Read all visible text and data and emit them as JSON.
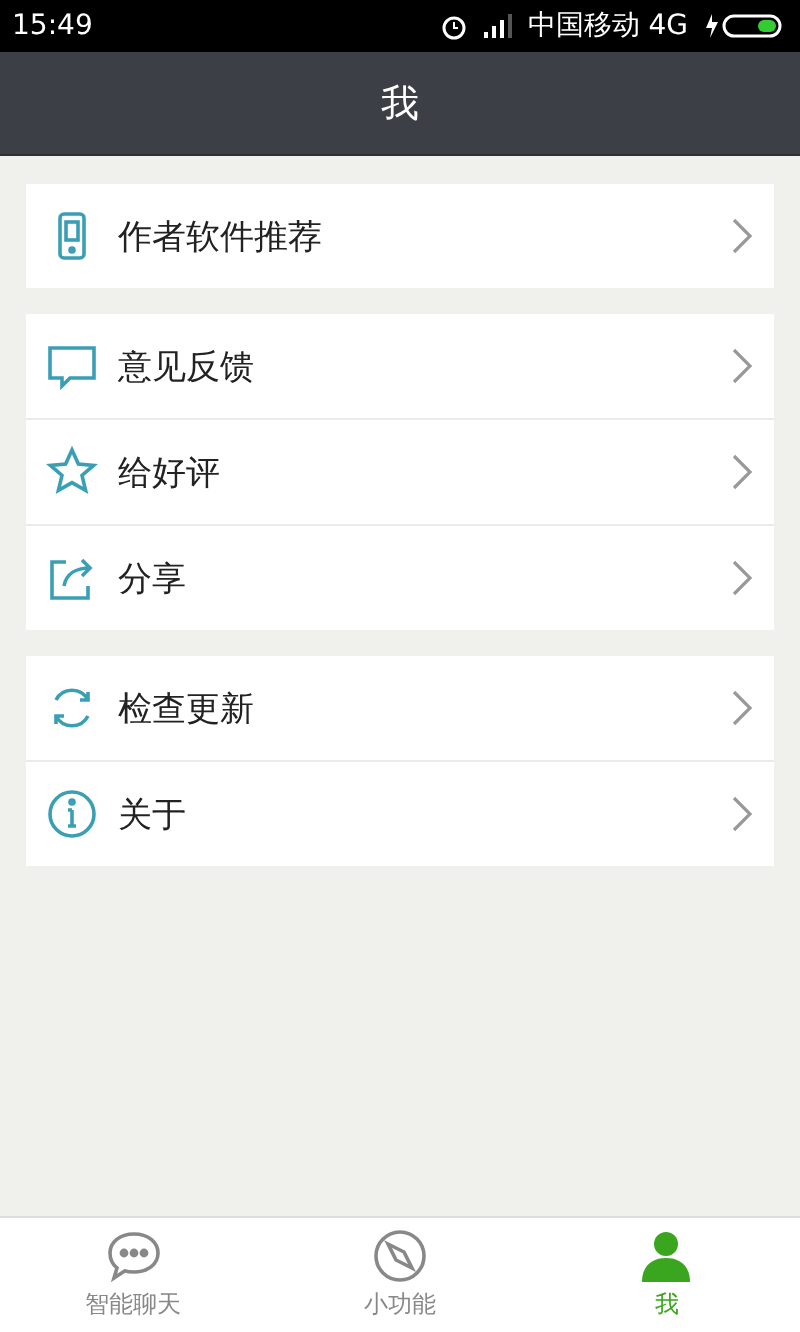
{
  "status_bar": {
    "time": "15:49",
    "carrier": "中国移动 4G"
  },
  "header": {
    "title": "我"
  },
  "groups": [
    {
      "items": [
        {
          "kind": "phone",
          "label": "作者软件推荐"
        }
      ]
    },
    {
      "items": [
        {
          "kind": "chat",
          "label": "意见反馈"
        },
        {
          "kind": "star",
          "label": "给好评"
        },
        {
          "kind": "share",
          "label": "分享"
        }
      ]
    },
    {
      "items": [
        {
          "kind": "refresh",
          "label": "检查更新"
        },
        {
          "kind": "info",
          "label": "关于"
        }
      ]
    }
  ],
  "tabs": [
    {
      "kind": "chat",
      "label": "智能聊天",
      "selected": false
    },
    {
      "kind": "compass",
      "label": "小功能",
      "selected": false
    },
    {
      "kind": "person",
      "label": "我",
      "selected": true
    }
  ]
}
